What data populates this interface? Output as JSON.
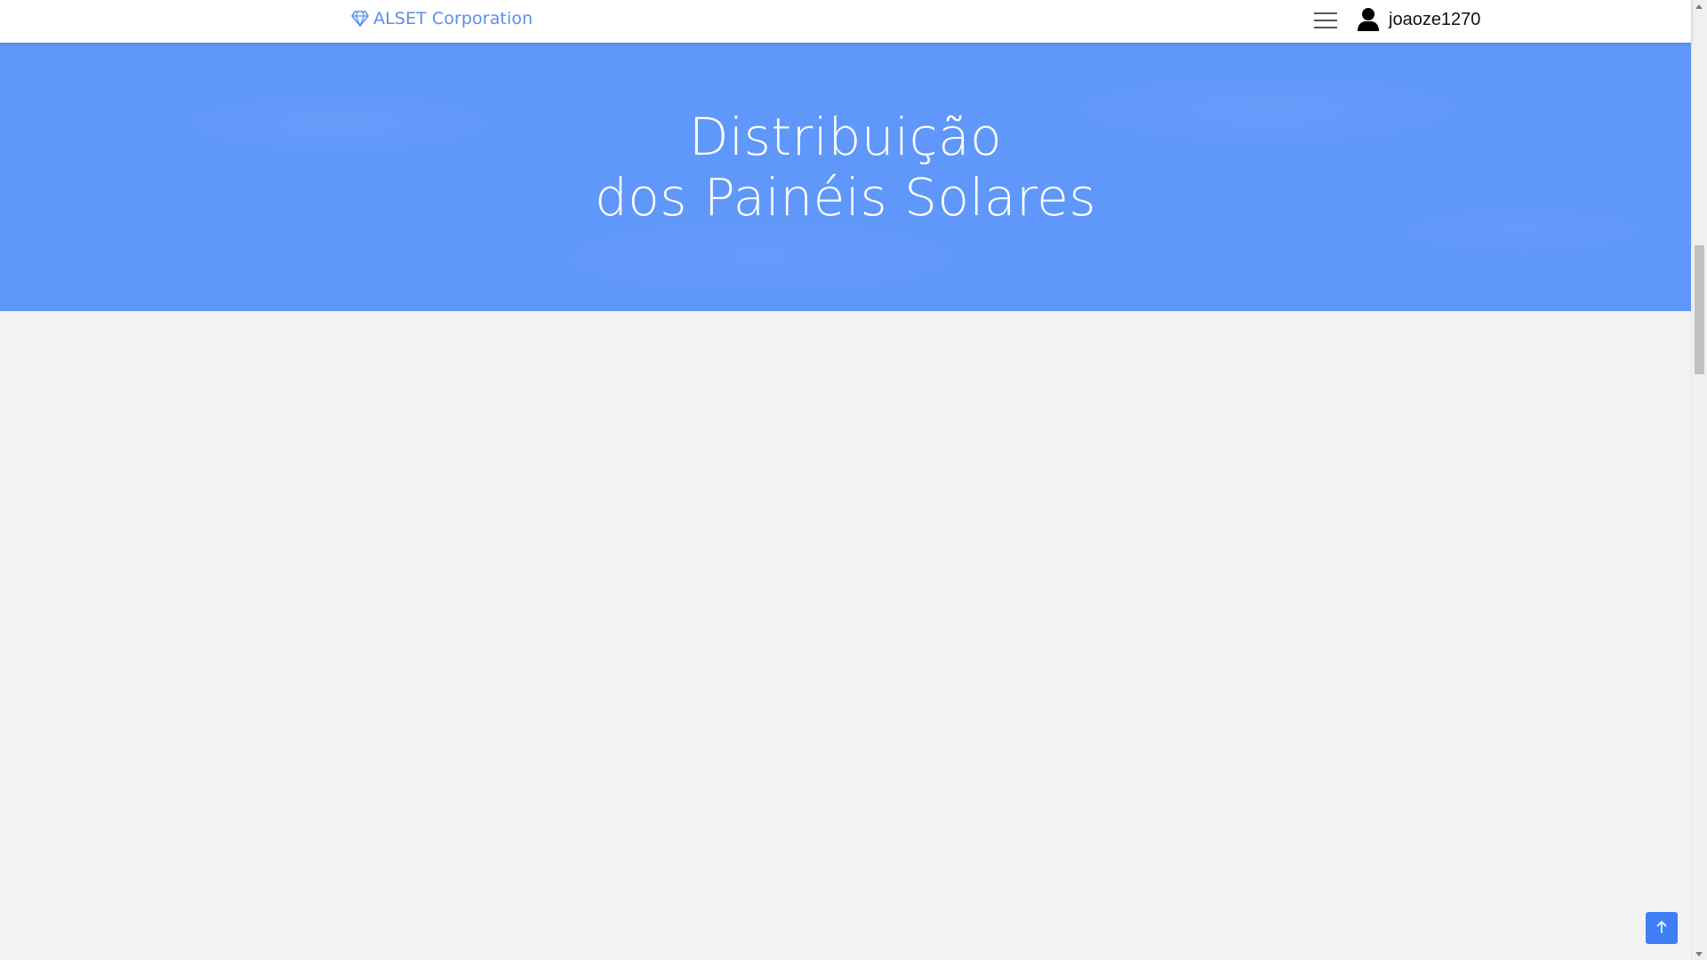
{
  "navbar": {
    "brand": {
      "icon": "diamond-icon",
      "label": "ALSET Corporation"
    },
    "menu_icon": "hamburger-menu-icon",
    "user": {
      "icon": "user-icon",
      "name": "joaoze1270"
    }
  },
  "hero": {
    "title_line1": "Distribuição",
    "title_line2": "dos Painéis Solares"
  },
  "back_to_top": {
    "icon": "arrow-up-icon"
  },
  "colors": {
    "hero_background": "#5f97fa",
    "brand": "#5b8ef0",
    "back_to_top": "#3f7ef5",
    "page_background": "#f2f2f2"
  }
}
